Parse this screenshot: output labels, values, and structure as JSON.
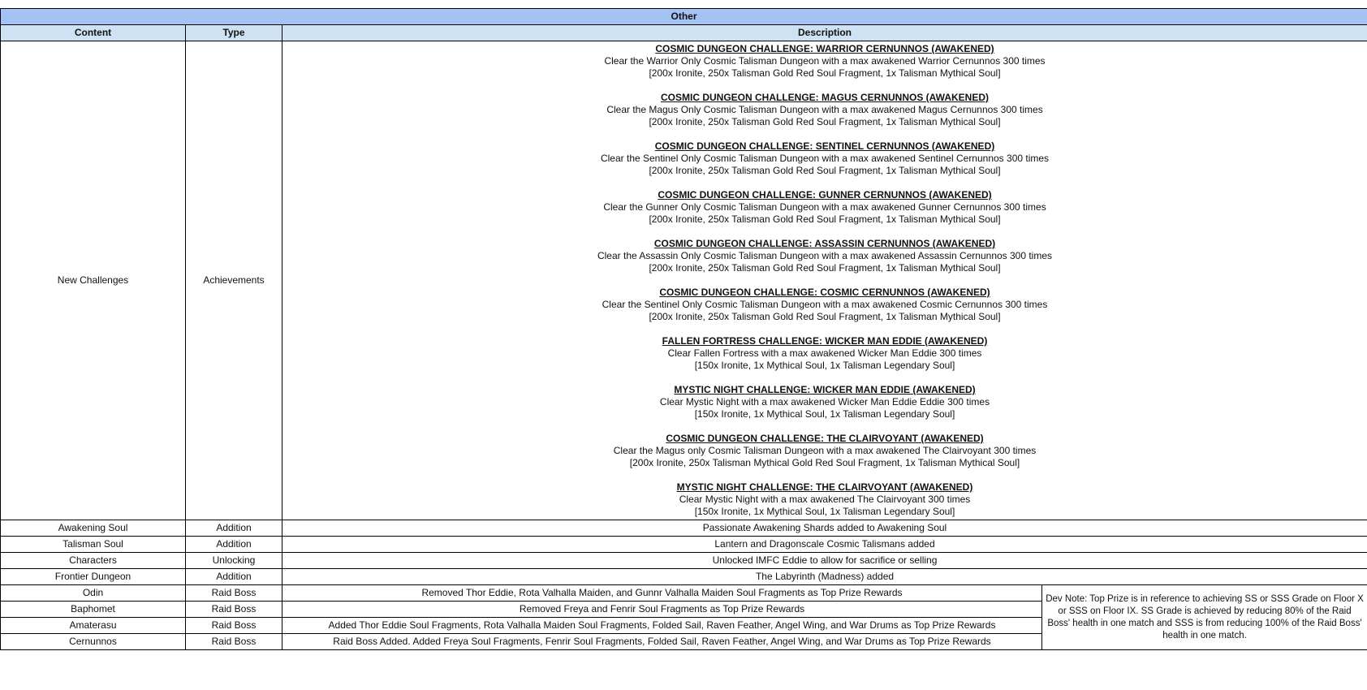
{
  "table": {
    "title": "Other",
    "headers": {
      "content": "Content",
      "type": "Type",
      "description": "Description"
    },
    "challenges_row": {
      "content": "New Challenges",
      "type": "Achievements",
      "challenges": [
        {
          "title": "COSMIC DUNGEON CHALLENGE: WARRIOR CERNUNNOS (AWAKENED)",
          "text": "Clear the Warrior Only Cosmic Talisman Dungeon with a max awakened Warrior Cernunnos 300 times",
          "reward": "[200x Ironite, 250x Talisman Gold Red Soul Fragment, 1x Talisman Mythical Soul]"
        },
        {
          "title": "COSMIC DUNGEON CHALLENGE: MAGUS CERNUNNOS (AWAKENED)",
          "text": "Clear the Magus Only Cosmic Talisman Dungeon with a max awakened Magus Cernunnos 300 times",
          "reward": "[200x Ironite, 250x Talisman Gold Red Soul Fragment, 1x Talisman Mythical Soul]"
        },
        {
          "title": "COSMIC DUNGEON CHALLENGE: SENTINEL CERNUNNOS (AWAKENED)",
          "text": "Clear the Sentinel Only Cosmic Talisman Dungeon with a max awakened Sentinel Cernunnos 300 times",
          "reward": "[200x Ironite, 250x Talisman Gold Red Soul Fragment, 1x Talisman Mythical Soul]"
        },
        {
          "title": "COSMIC DUNGEON CHALLENGE: GUNNER CERNUNNOS (AWAKENED)",
          "text": "Clear the Gunner Only Cosmic Talisman Dungeon with a max awakened Gunner Cernunnos 300 times",
          "reward": "[200x Ironite, 250x Talisman Gold Red Soul Fragment, 1x Talisman Mythical Soul]"
        },
        {
          "title": "COSMIC DUNGEON CHALLENGE: ASSASSIN CERNUNNOS (AWAKENED)",
          "text": "Clear the Assassin Only Cosmic Talisman Dungeon with a max awakened Assassin Cernunnos 300 times",
          "reward": "[200x Ironite, 250x Talisman Gold Red Soul Fragment, 1x Talisman Mythical Soul]"
        },
        {
          "title": "COSMIC DUNGEON CHALLENGE: COSMIC CERNUNNOS (AWAKENED)",
          "text": "Clear the Sentinel Only Cosmic Talisman Dungeon with a max awakened Cosmic Cernunnos 300 times",
          "reward": "[200x Ironite, 250x Talisman Gold Red Soul Fragment, 1x Talisman Mythical Soul]"
        },
        {
          "title": "FALLEN FORTRESS CHALLENGE: WICKER MAN EDDIE (AWAKENED)",
          "text": "Clear Fallen Fortress with a max awakened Wicker Man Eddie 300 times",
          "reward": "[150x Ironite, 1x Mythical Soul, 1x Talisman Legendary Soul]"
        },
        {
          "title": "MYSTIC NIGHT CHALLENGE: WICKER MAN EDDIE (AWAKENED)",
          "text": "Clear Mystic Night with a max awakened Wicker Man Eddie Eddie 300 times",
          "reward": "[150x Ironite, 1x Mythical Soul, 1x Talisman Legendary Soul]"
        },
        {
          "title": "COSMIC DUNGEON CHALLENGE: THE CLAIRVOYANT (AWAKENED)",
          "text": "Clear the Magus only Cosmic Talisman Dungeon with a max awakened The Clairvoyant 300 times",
          "reward": "[200x Ironite, 250x Talisman Mythical Gold Red Soul Fragment, 1x Talisman Mythical Soul]"
        },
        {
          "title": "MYSTIC NIGHT CHALLENGE: THE CLAIRVOYANT (AWAKENED)",
          "text": "Clear Mystic Night with a max awakened The Clairvoyant 300 times",
          "reward": "[150x Ironite, 1x Mythical Soul, 1x Talisman Legendary Soul]"
        }
      ]
    },
    "rows": [
      {
        "content": "Awakening Soul",
        "type": "Addition",
        "description": "Passionate Awakening Shards added to Awakening Soul"
      },
      {
        "content": "Talisman Soul",
        "type": "Addition",
        "description": "Lantern and Dragonscale Cosmic Talismans added"
      },
      {
        "content": "Characters",
        "type": "Unlocking",
        "description": "Unlocked IMFC Eddie to allow for sacrifice or selling"
      },
      {
        "content": "Frontier Dungeon",
        "type": "Addition",
        "description": "The Labyrinth (Madness) added"
      }
    ],
    "raid_rows": [
      {
        "content": "Odin",
        "type": "Raid Boss",
        "description": "Removed Thor Eddie, Rota Valhalla Maiden, and Gunnr Valhalla Maiden Soul Fragments as Top Prize Rewards"
      },
      {
        "content": "Baphomet",
        "type": "Raid Boss",
        "description": "Removed Freya and Fenrir Soul Fragments as Top Prize Rewards"
      },
      {
        "content": "Amaterasu",
        "type": "Raid Boss",
        "description": "Added Thor Eddie Soul Fragments, Rota Valhalla Maiden Soul Fragments, Folded Sail, Raven Feather, Angel Wing, and War Drums as Top Prize Rewards"
      },
      {
        "content": "Cernunnos",
        "type": "Raid Boss",
        "description": "Raid Boss Added. Added Freya Soul Fragments, Fenrir Soul Fragments, Folded Sail, Raven Feather, Angel Wing, and War Drums as Top Prize Rewards"
      }
    ],
    "dev_note": "Dev Note: Top Prize is in reference to achieving SS or SSS Grade on Floor X or SSS on Floor IX. SS Grade is achieved by reducing 80% of the Raid Boss' health in one match and SSS is from reducing 100% of the Raid Boss' health in one match."
  }
}
